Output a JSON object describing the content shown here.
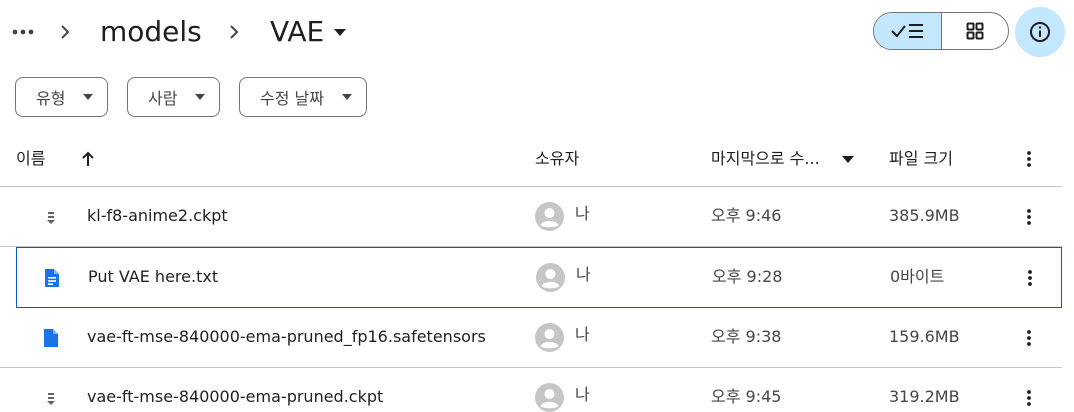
{
  "breadcrumb": {
    "more_icon": "more-horiz-icon",
    "separator_icon": "chevron-right-icon",
    "parent": "models",
    "current": "VAE",
    "current_icon": "caret-down-icon"
  },
  "view_toggle": {
    "list_icon": "check-list-icon",
    "grid_icon": "grid-icon",
    "selected": "list"
  },
  "info_icon": "info-icon",
  "filters": [
    {
      "label": "유형",
      "icon": "caret-down-icon"
    },
    {
      "label": "사람",
      "icon": "caret-down-icon"
    },
    {
      "label": "수정 날짜",
      "icon": "caret-down-icon"
    }
  ],
  "table": {
    "headers": {
      "name": "이름",
      "owner": "소유자",
      "modified": "마지막으로 수...",
      "size": "파일 크기"
    },
    "name_sort_icon": "arrow-up-icon",
    "modified_sort_icon": "caret-down-icon",
    "rows": [
      {
        "name": "kl-f8-anime2.ckpt",
        "icon": "binary-file-icon",
        "owner": "나",
        "modified": "오후 9:46",
        "size": "385.9MB",
        "selected": false
      },
      {
        "name": "Put VAE here.txt",
        "icon": "document-icon",
        "owner": "나",
        "modified": "오후 9:28",
        "size": "0바이트",
        "selected": true
      },
      {
        "name": "vae-ft-mse-840000-ema-pruned_fp16.safetensors",
        "icon": "document-icon",
        "owner": "나",
        "modified": "오후 9:38",
        "size": "159.6MB",
        "selected": false
      },
      {
        "name": "vae-ft-mse-840000-ema-pruned.ckpt",
        "icon": "binary-file-icon",
        "owner": "나",
        "modified": "오후 9:45",
        "size": "319.2MB",
        "selected": false
      }
    ]
  },
  "colors": {
    "accent": "#0b57d0",
    "selected_fill": "#c2e7ff",
    "doc_icon": "#1a73e8",
    "binary_icon": "#5f6368",
    "avatar": "#c4c7c5"
  }
}
